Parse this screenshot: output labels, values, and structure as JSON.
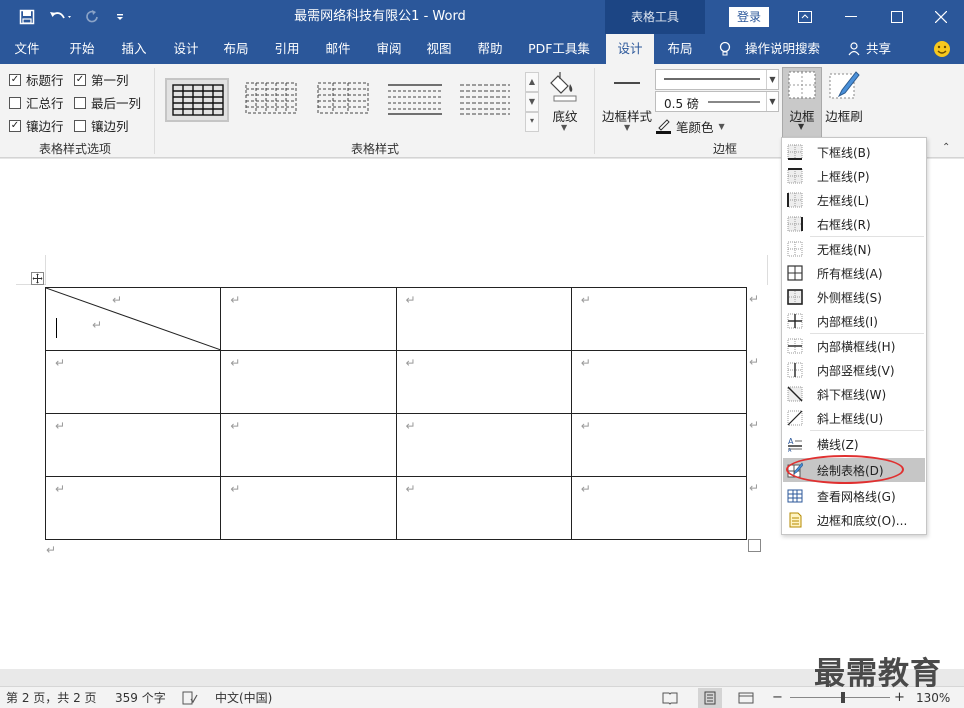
{
  "window": {
    "title": "最需网络科技有限公1 - Word",
    "context_tab": "表格工具",
    "login_label": "登录"
  },
  "tabs": [
    "文件",
    "开始",
    "插入",
    "设计",
    "布局",
    "引用",
    "邮件",
    "审阅",
    "视图",
    "帮助",
    "PDF工具集",
    "设计",
    "布局"
  ],
  "tell_me": "操作说明搜索",
  "share": "共享",
  "ribbon": {
    "style_options": {
      "label": "表格样式选项",
      "items": [
        {
          "label": "标题行",
          "checked": true
        },
        {
          "label": "第一列",
          "checked": true
        },
        {
          "label": "汇总行",
          "checked": false
        },
        {
          "label": "最后一列",
          "checked": false
        },
        {
          "label": "镶边行",
          "checked": true
        },
        {
          "label": "镶边列",
          "checked": false
        }
      ]
    },
    "table_styles": {
      "label": "表格样式"
    },
    "shading_label": "底纹",
    "borders": {
      "label": "边框",
      "border_styles_label": "边框样式",
      "weight_value": "0.5 磅",
      "pen_color_label": "笔颜色",
      "borders_label": "边框",
      "border_painter_label": "边框刷"
    }
  },
  "menu": {
    "items": [
      {
        "label": "下框线(B)",
        "icon": "border-bottom-icon"
      },
      {
        "label": "上框线(P)",
        "icon": "border-top-icon"
      },
      {
        "label": "左框线(L)",
        "icon": "border-left-icon"
      },
      {
        "label": "右框线(R)",
        "icon": "border-right-icon"
      },
      {
        "label": "无框线(N)",
        "icon": "border-none-icon"
      },
      {
        "label": "所有框线(A)",
        "icon": "border-all-icon"
      },
      {
        "label": "外侧框线(S)",
        "icon": "border-outside-icon"
      },
      {
        "label": "内部框线(I)",
        "icon": "border-inside-icon"
      },
      {
        "label": "内部横框线(H)",
        "icon": "border-inside-horizontal-icon"
      },
      {
        "label": "内部竖框线(V)",
        "icon": "border-inside-vertical-icon"
      },
      {
        "label": "斜下框线(W)",
        "icon": "diagonal-down-icon"
      },
      {
        "label": "斜上框线(U)",
        "icon": "diagonal-up-icon"
      },
      {
        "label": "横线(Z)",
        "icon": "horizontal-line-icon"
      },
      {
        "label": "绘制表格(D)",
        "icon": "draw-table-icon"
      },
      {
        "label": "查看网格线(G)",
        "icon": "gridlines-icon"
      },
      {
        "label": "边框和底纹(O)...",
        "icon": "borders-shading-icon"
      }
    ],
    "highlighted": "绘制表格(D)"
  },
  "status": {
    "page": "第 2 页，共 2 页",
    "words": "359 个字",
    "language": "中文(中国)",
    "zoom": "130%"
  },
  "watermark": "最需教育"
}
